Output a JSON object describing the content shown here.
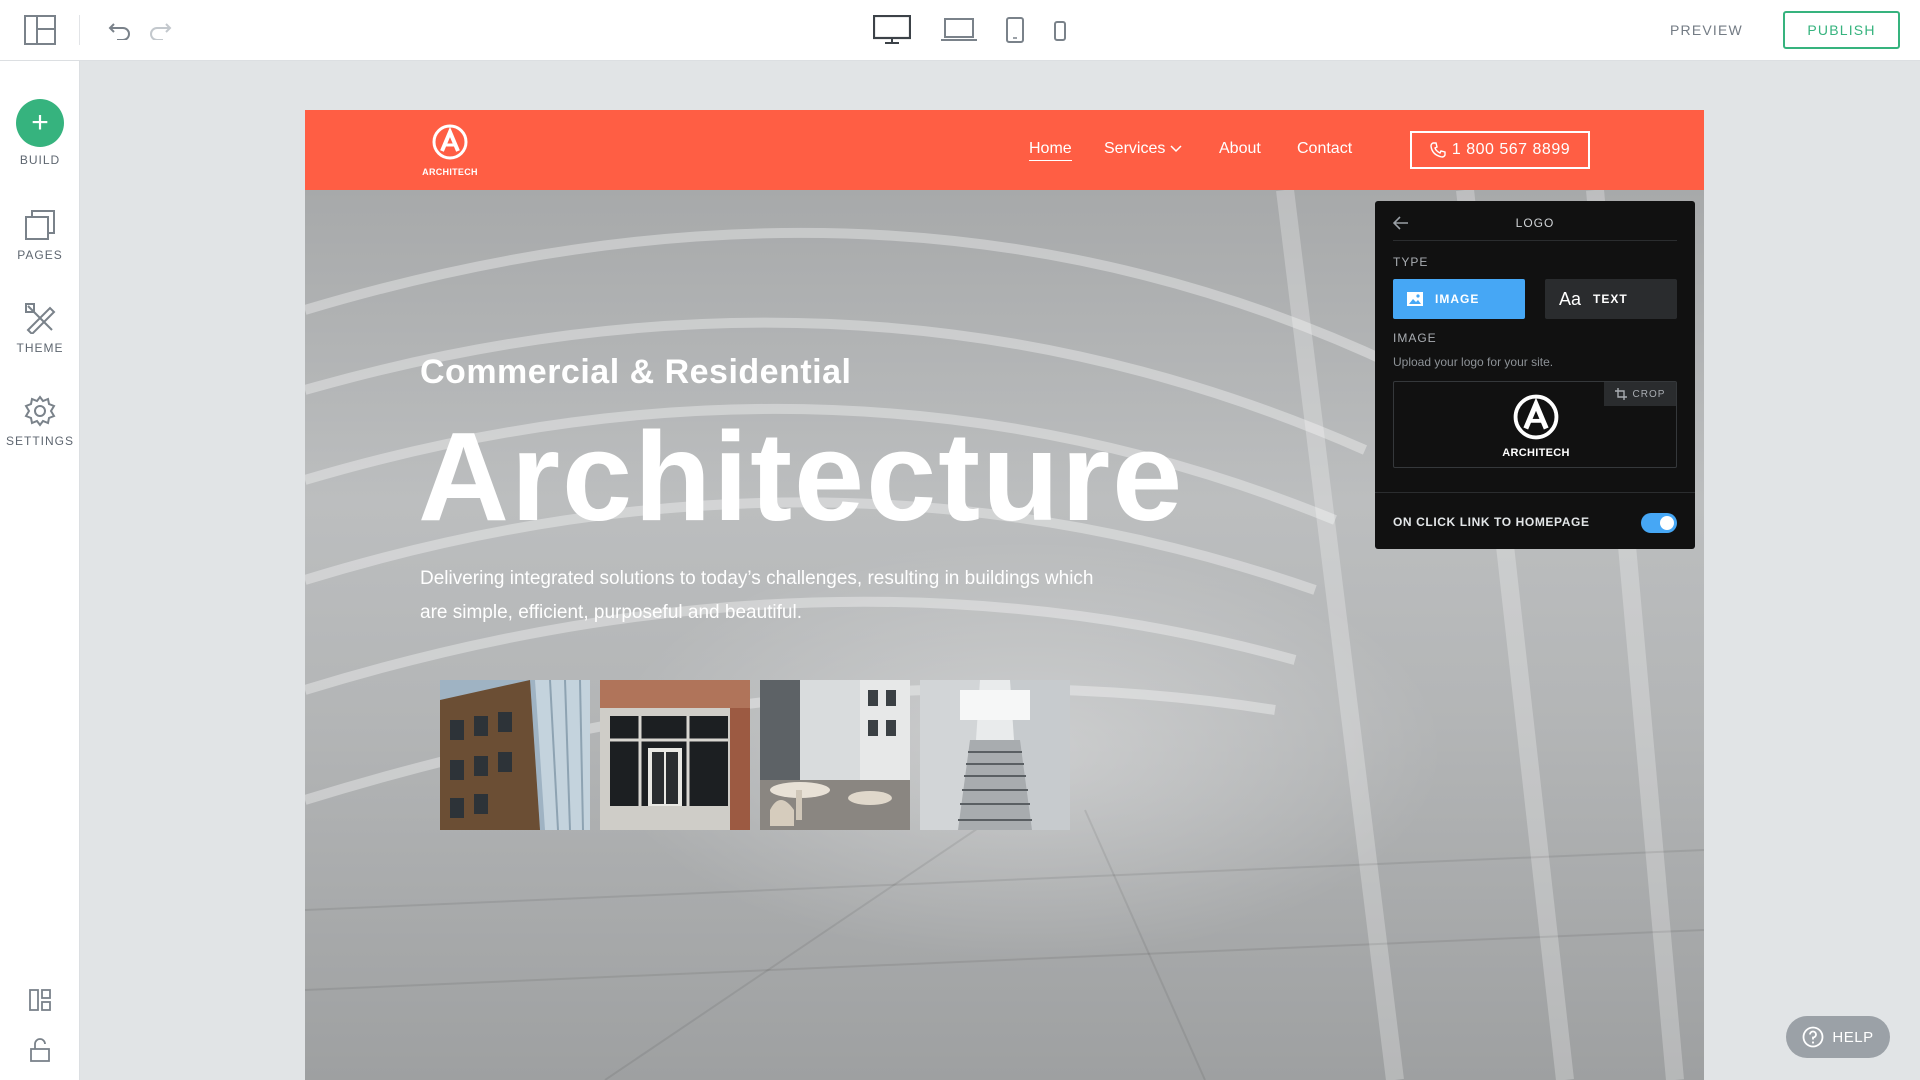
{
  "toolbar": {
    "preview_label": "PREVIEW",
    "publish_label": "PUBLISH",
    "icons": [
      "layout-icon",
      "undo-icon",
      "redo-icon",
      "desktop-icon",
      "laptop-icon",
      "tablet-icon",
      "mobile-icon"
    ]
  },
  "sidebar": {
    "items": [
      {
        "label": "BUILD",
        "icon": "plus-icon"
      },
      {
        "label": "PAGES",
        "icon": "pages-icon"
      },
      {
        "label": "THEME",
        "icon": "theme-icon"
      },
      {
        "label": "SETTINGS",
        "icon": "gear-icon"
      }
    ],
    "bottom_icons": [
      "layout-grid-icon",
      "unlock-icon"
    ]
  },
  "site": {
    "brand_color": "#ff5e44",
    "logo_text": "ARCHITECH",
    "nav": {
      "home": "Home",
      "services": "Services",
      "about": "About",
      "contact": "Contact"
    },
    "phone": "1 800 567 8899",
    "hero": {
      "subtitle": "Commercial & Residential",
      "title": "Architecture",
      "description": "Delivering integrated solutions to today’s challenges, resulting in buildings which are simple, efficient, purposeful and beautiful."
    }
  },
  "panel": {
    "title": "LOGO",
    "type_label": "TYPE",
    "type_image": "IMAGE",
    "type_text": "TEXT",
    "text_glyph": "Aa",
    "image_label": "IMAGE",
    "upload_hint": "Upload your logo for your site.",
    "crop_label": "CROP",
    "logo_text": "ARCHITECH",
    "toggle_label": "ON CLICK LINK TO HOMEPAGE",
    "toggle_on": true,
    "accent": "#46a7f5"
  },
  "help": {
    "label": "HELP"
  }
}
